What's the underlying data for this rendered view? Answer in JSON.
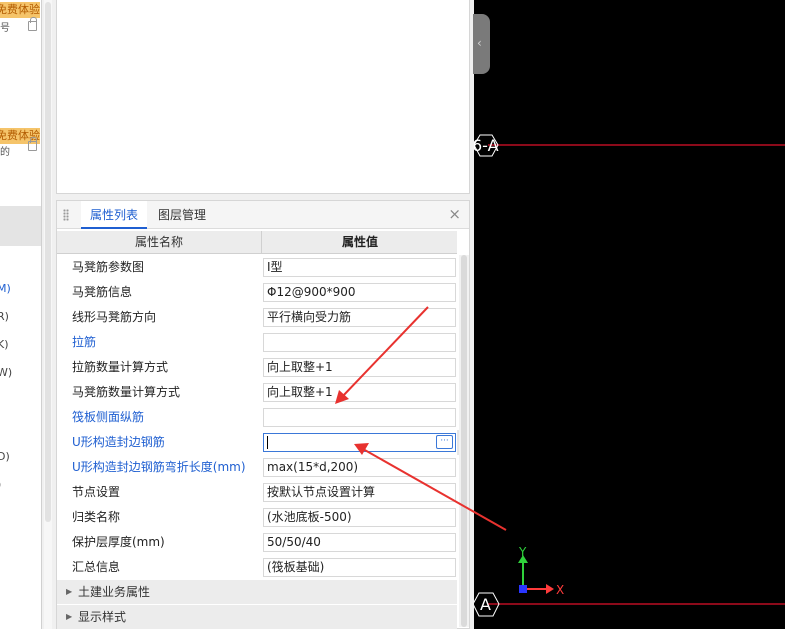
{
  "left_strip": {
    "trial_label": "免费体验",
    "fragments": [
      "M)",
      "R)",
      "K)",
      "W)",
      "D)",
      ")"
    ],
    "small_fragments": [
      "号",
      "的"
    ]
  },
  "panel": {
    "tabs": [
      "属性列表",
      "图层管理"
    ],
    "close_glyph": "×",
    "headers": {
      "name": "属性名称",
      "value": "属性值"
    },
    "rows": [
      {
        "name": "马凳筋参数图",
        "value": "Ⅰ型",
        "blue": false
      },
      {
        "name": "马凳筋信息",
        "value": "Φ12@900*900",
        "blue": false
      },
      {
        "name": "线形马凳筋方向",
        "value": "平行横向受力筋",
        "blue": false
      },
      {
        "name": "拉筋",
        "value": "",
        "blue": true
      },
      {
        "name": "拉筋数量计算方式",
        "value": "向上取整+1",
        "blue": false
      },
      {
        "name": "马凳筋数量计算方式",
        "value": "向上取整+1",
        "blue": false
      },
      {
        "name": "筏板侧面纵筋",
        "value": "",
        "blue": true
      },
      {
        "name": "U形构造封边钢筋",
        "value": "",
        "blue": true,
        "active": true
      },
      {
        "name": "U形构造封边钢筋弯折长度(mm)",
        "value": "max(15*d,200)",
        "blue": true
      },
      {
        "name": "节点设置",
        "value": "按默认节点设置计算",
        "blue": false
      },
      {
        "name": "归类名称",
        "value": "(水池底板-500)",
        "blue": false
      },
      {
        "name": "保护层厚度(mm)",
        "value": "50/50/40",
        "blue": false
      },
      {
        "name": "汇总信息",
        "value": "(筏板基础)",
        "blue": false
      }
    ],
    "groups": [
      "土建业务属性",
      "显示样式"
    ],
    "ellipsis": "···"
  },
  "viewport": {
    "axis_label_top": "6-A",
    "axis_label_bottom": "A",
    "ucs_x": "X",
    "ucs_y": "Y",
    "colors": {
      "background": "#000000",
      "axis_line": "#e0102a",
      "arrow": "#e8322f",
      "ucs_x": "#ff3b3b",
      "ucs_y": "#2fd13b",
      "origin": "#2a36ff"
    }
  },
  "handle_glyph": "‹"
}
